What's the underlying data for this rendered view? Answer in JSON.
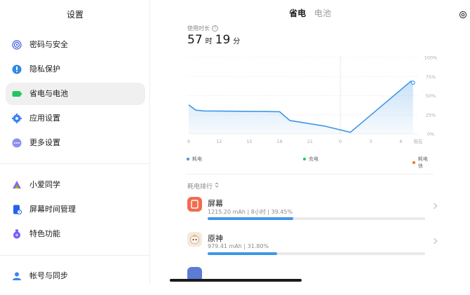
{
  "sidebar": {
    "title": "设置",
    "groups": [
      [
        {
          "label": "密码与安全",
          "icon": "fingerprint-icon",
          "color": "#3b5bdb",
          "active": false
        },
        {
          "label": "隐私保护",
          "icon": "privacy-shield-icon",
          "color": "#2f8ae0",
          "active": false
        },
        {
          "label": "省电与电池",
          "icon": "battery-icon",
          "color": "#22c55e",
          "active": true
        },
        {
          "label": "应用设置",
          "icon": "app-gear-icon",
          "color": "#3b82f6",
          "active": false
        },
        {
          "label": "更多设置",
          "icon": "more-dots-icon",
          "color": "#6366f1",
          "active": false
        }
      ],
      [
        {
          "label": "小爱同学",
          "icon": "xiaoai-icon",
          "color": "#7c3aed",
          "active": false
        },
        {
          "label": "屏幕时间管理",
          "icon": "screen-time-icon",
          "color": "#2563eb",
          "active": false
        },
        {
          "label": "特色功能",
          "icon": "feature-flask-icon",
          "color": "#6d5dfc",
          "active": false
        }
      ],
      [
        {
          "label": "帐号与同步",
          "icon": "account-icon",
          "color": "#3b82f6",
          "active": false
        }
      ]
    ]
  },
  "header": {
    "tabs": [
      {
        "label": "省电",
        "active": true
      },
      {
        "label": "电池",
        "active": false
      }
    ]
  },
  "usage": {
    "label": "使用时长",
    "hours": "57",
    "hours_unit": "时",
    "minutes": "19",
    "minutes_unit": "分"
  },
  "chart_data": {
    "type": "area",
    "x_ticks": [
      "9",
      "12",
      "15",
      "18",
      "21",
      "0",
      "3",
      "6",
      "现在"
    ],
    "y_ticks": [
      "0%",
      "25%",
      "50%",
      "75%",
      "100%"
    ],
    "ylim": [
      0,
      100
    ],
    "series": [
      {
        "name": "耗电",
        "color": "#3e97e8",
        "points": [
          [
            9,
            38
          ],
          [
            9.7,
            31
          ],
          [
            10.5,
            30
          ],
          [
            18,
            29
          ],
          [
            18.5,
            23
          ],
          [
            19,
            17.5
          ],
          [
            22.5,
            10
          ],
          [
            25,
            2
          ],
          [
            31,
            69
          ],
          [
            31.2,
            67
          ]
        ]
      }
    ]
  },
  "legend": [
    {
      "label": "耗电",
      "color": "#3e97e8"
    },
    {
      "label": "充电",
      "color": "#22c55e"
    },
    {
      "label": "耗电快",
      "color": "#f97316"
    }
  ],
  "ranking": {
    "title": "耗电排行",
    "apps": [
      {
        "name": "屏幕",
        "stats": "1215.20 mAh | 8小时 | 39.45%",
        "percent": 39.45,
        "icon_color": "#f26b4f",
        "icon": "screen-icon"
      },
      {
        "name": "原神",
        "stats": "979.41 mAh | 31.80%",
        "percent": 31.8,
        "icon_color": "#f5e9dd",
        "icon": "genshin-icon"
      }
    ]
  }
}
